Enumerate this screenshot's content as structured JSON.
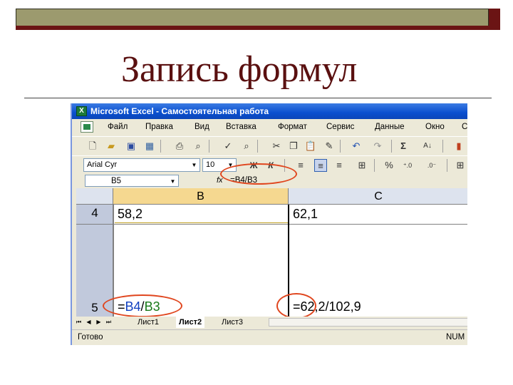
{
  "slide": {
    "title": "Запись формул"
  },
  "window": {
    "title": "Microsoft Excel - Самостоятельная работа",
    "icon": "excel-icon"
  },
  "menu": [
    "Файл",
    "Правка",
    "Вид",
    "Вставка",
    "Формат",
    "Сервис",
    "Данные",
    "Окно",
    "С"
  ],
  "toolbar": {
    "font_name": "Arial Cyr",
    "font_size": "10",
    "bold_label": "Ж",
    "italic_label": "К",
    "percent_label": "%",
    "sigma_label": "Σ"
  },
  "formula_bar": {
    "name_box": "B5",
    "fx": "fx",
    "formula": "=B4/B3"
  },
  "grid": {
    "columns": [
      "B",
      "C"
    ],
    "rows": [
      "4",
      "5"
    ],
    "cells": {
      "B4": "58,2",
      "C4": "62,1",
      "B5": {
        "eq": "=",
        "ref1": "B4",
        "op": "/",
        "ref2": "B3"
      },
      "C5": "=62,2/102,9"
    }
  },
  "sheets": {
    "tabs": [
      "Лист1",
      "Лист2",
      "Лист3"
    ],
    "active": "Лист2"
  },
  "status": {
    "left": "Готово",
    "right": "NUM"
  },
  "colors": {
    "accent": "#e0461e",
    "ref_b4": "#1040c0",
    "ref_b3": "#187a18",
    "title": "#5a1010"
  }
}
